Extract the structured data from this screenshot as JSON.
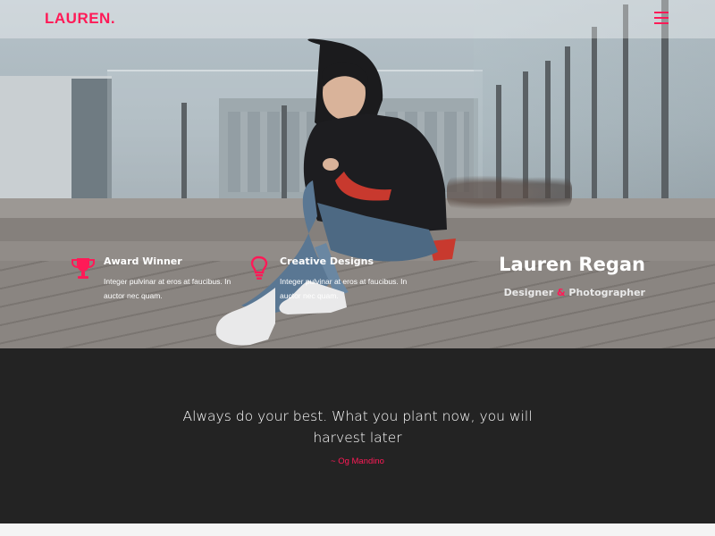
{
  "header": {
    "logo": "LAUREN.",
    "menu_icon": "hamburger-menu-icon"
  },
  "hero": {
    "features": [
      {
        "icon": "trophy-icon",
        "title": "Award Winner",
        "description": "Integer pulvinar at eros at faucibus. In auctor nec quam."
      },
      {
        "icon": "lightbulb-icon",
        "title": "Creative Designs",
        "description": "Integer pulvinar at eros at faucibus. In auctor nec quam."
      }
    ],
    "name": "Lauren Regan",
    "role_part1": "Designer ",
    "role_amp": "&",
    "role_part2": " Photographer"
  },
  "quote": {
    "text": "Always do your best. What you plant now, you will harvest later",
    "author": "~ Og Mandino"
  },
  "colors": {
    "accent": "#ff1a57",
    "dark_section": "#232323"
  }
}
